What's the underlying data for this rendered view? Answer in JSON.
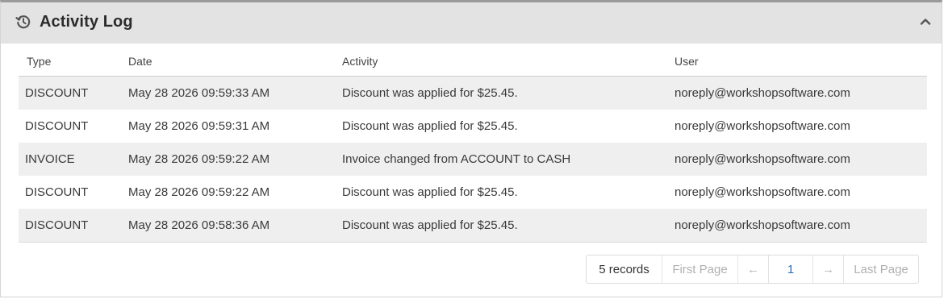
{
  "panel": {
    "title": "Activity Log",
    "icon": "history-icon",
    "collapse_icon": "chevron-up-icon"
  },
  "table": {
    "headers": [
      "Type",
      "Date",
      "Activity",
      "User"
    ],
    "rows": [
      [
        "DISCOUNT",
        "May 28 2026 09:59:33 AM",
        "Discount was applied for $25.45.",
        "noreply@workshopsoftware.com"
      ],
      [
        "DISCOUNT",
        "May 28 2026 09:59:31 AM",
        "Discount was applied for $25.45.",
        "noreply@workshopsoftware.com"
      ],
      [
        "INVOICE",
        "May 28 2026 09:59:22 AM",
        "Invoice changed from ACCOUNT to CASH",
        "noreply@workshopsoftware.com"
      ],
      [
        "DISCOUNT",
        "May 28 2026 09:59:22 AM",
        "Discount was applied for $25.45.",
        "noreply@workshopsoftware.com"
      ],
      [
        "DISCOUNT",
        "May 28 2026 09:58:36 AM",
        "Discount was applied for $25.45.",
        "noreply@workshopsoftware.com"
      ]
    ]
  },
  "pagination": {
    "records": "5 records",
    "first": "First Page",
    "prev": "←",
    "current": "1",
    "next": "→",
    "last": "Last Page"
  },
  "colors": {
    "header_bg": "#e3e3e3",
    "row_stripe": "#efefef",
    "current_page": "#2d6fb8"
  }
}
